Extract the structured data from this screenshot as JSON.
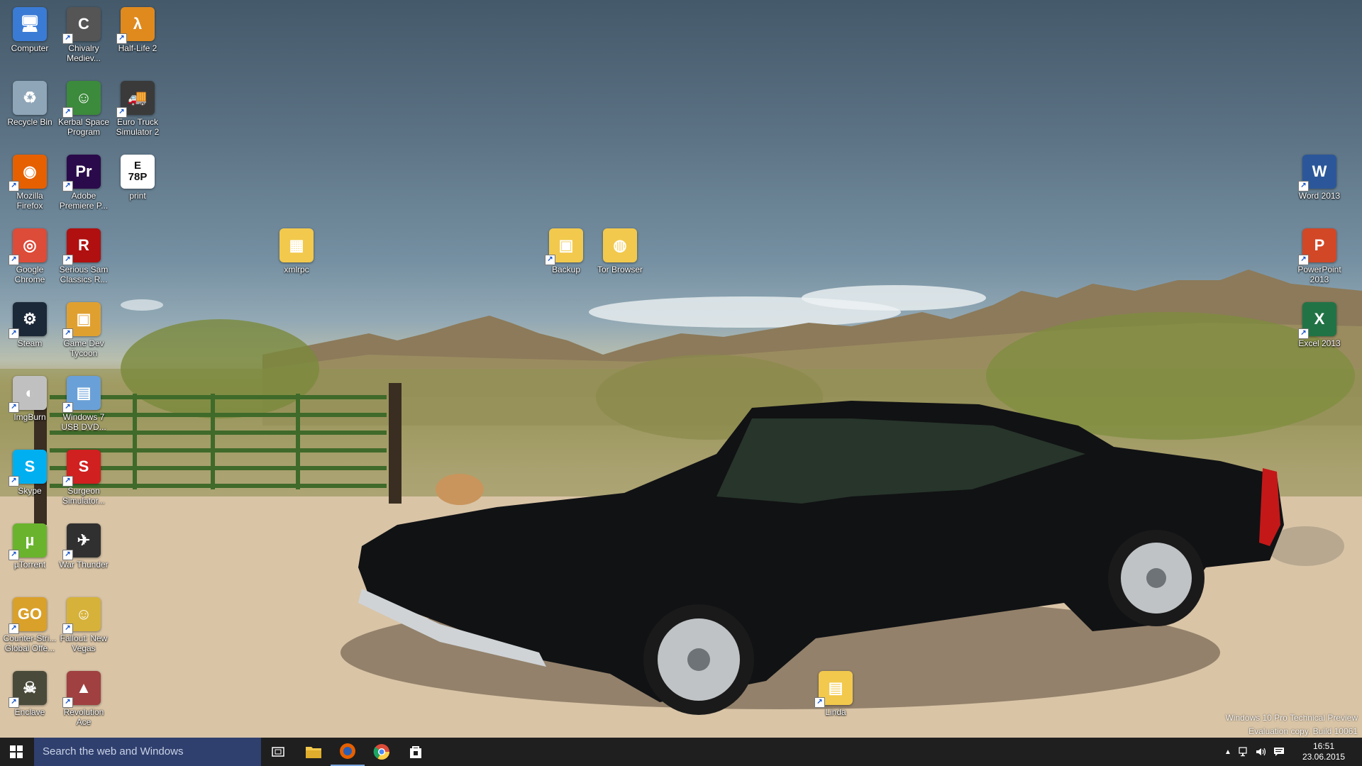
{
  "desktop": {
    "icons": [
      {
        "label": "Computer",
        "glyph": "🖥",
        "color": "#3a7bd5",
        "shortcut": false
      },
      {
        "label": "Chivalry\nMediev...",
        "glyph": "C",
        "color": "#555555",
        "shortcut": true
      },
      {
        "label": "Half-Life 2",
        "glyph": "λ",
        "color": "#e08a1e",
        "shortcut": true
      },
      {
        "label": "Recycle Bin",
        "glyph": "♻",
        "color": "#8fa6b8",
        "shortcut": false
      },
      {
        "label": "Kerbal Space\nProgram",
        "glyph": "☺",
        "color": "#3c8a3c",
        "shortcut": true
      },
      {
        "label": "Euro Truck\nSimulator 2",
        "glyph": "🚚",
        "color": "#3a3a3a",
        "shortcut": true
      },
      {
        "label": "Mozilla\nFirefox",
        "glyph": "◉",
        "color": "#e66000",
        "shortcut": true
      },
      {
        "label": "Adobe\nPremiere P...",
        "glyph": "Pr",
        "color": "#2a0a4a",
        "shortcut": true
      },
      {
        "label": "print",
        "glyph": "E\n78P",
        "color": "#ffffff",
        "shortcut": false
      },
      {
        "label": "Google\nChrome",
        "glyph": "◎",
        "color": "#dd4b39",
        "shortcut": true
      },
      {
        "label": "Serious Sam\nClassics R...",
        "glyph": "R",
        "color": "#b01010",
        "shortcut": true
      },
      {
        "label": "Steam",
        "glyph": "⚙",
        "color": "#1b2838",
        "shortcut": true
      },
      {
        "label": "Game Dev\nTycoon",
        "glyph": "▣",
        "color": "#e0a030",
        "shortcut": true
      },
      {
        "label": "ImgBurn",
        "glyph": "◐",
        "color": "#c0c0c0",
        "shortcut": true
      },
      {
        "label": "Windows 7\nUSB DVD...",
        "glyph": "▤",
        "color": "#6aa0d8",
        "shortcut": true
      },
      {
        "label": "Skype",
        "glyph": "S",
        "color": "#00aff0",
        "shortcut": true
      },
      {
        "label": "Surgeon\nSimulator...",
        "glyph": "S",
        "color": "#d02020",
        "shortcut": true
      },
      {
        "label": "µTorrent",
        "glyph": "µ",
        "color": "#6ab42d",
        "shortcut": true
      },
      {
        "label": "War Thunder",
        "glyph": "✈",
        "color": "#303030",
        "shortcut": true
      },
      {
        "label": "Counter-Stri...\nGlobal Offe...",
        "glyph": "GO",
        "color": "#d9a02a",
        "shortcut": true
      },
      {
        "label": "Fallout: New\nVegas",
        "glyph": "☺",
        "color": "#d6b23a",
        "shortcut": true
      },
      {
        "label": "Enclave",
        "glyph": "☠",
        "color": "#4a4a3a",
        "shortcut": true
      },
      {
        "label": "Revolution\nAce",
        "glyph": "▲",
        "color": "#a04040",
        "shortcut": true
      },
      {
        "label": "xmlrpc",
        "glyph": "▦",
        "color": "#f2c94c",
        "shortcut": false
      },
      {
        "label": "Backup",
        "glyph": "▣",
        "color": "#f2c94c",
        "shortcut": true
      },
      {
        "label": "Tor Browser",
        "glyph": "◍",
        "color": "#f2c94c",
        "shortcut": false
      },
      {
        "label": "Word 2013",
        "glyph": "W",
        "color": "#2b579a",
        "shortcut": true
      },
      {
        "label": "PowerPoint\n2013",
        "glyph": "P",
        "color": "#d24726",
        "shortcut": true
      },
      {
        "label": "Excel 2013",
        "glyph": "X",
        "color": "#217346",
        "shortcut": true
      },
      {
        "label": "Linda",
        "glyph": "▤",
        "color": "#f2c94c",
        "shortcut": true
      }
    ]
  },
  "watermark": {
    "line1": "Windows 10 Pro Technical Preview",
    "line2": "Evaluation copy. Build 10061"
  },
  "taskbar": {
    "start_icon": "windows-logo-icon",
    "search_placeholder": "Search the web and Windows",
    "pinned": [
      {
        "name": "task-view",
        "glyph": "▭"
      },
      {
        "name": "file-explorer",
        "glyph": "📁"
      },
      {
        "name": "firefox",
        "glyph": "◉"
      },
      {
        "name": "chrome",
        "glyph": "◎"
      },
      {
        "name": "store",
        "glyph": "🛍"
      }
    ],
    "tray": {
      "chevron": "▲",
      "time": "16:51",
      "date": "23.06.2015"
    }
  }
}
